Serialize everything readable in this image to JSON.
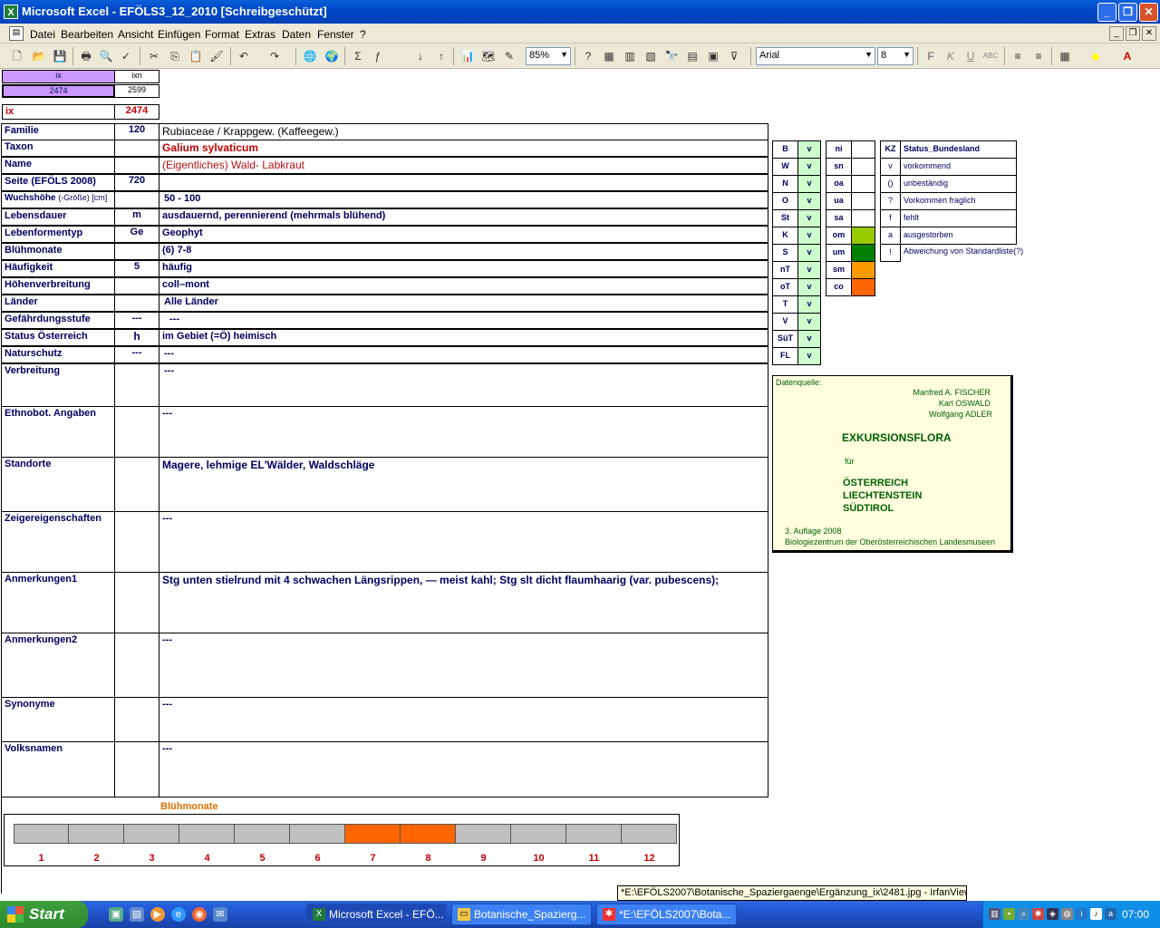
{
  "window": {
    "title": "Microsoft Excel - EFÖLS3_12_2010  [Schreibgeschützt]"
  },
  "menu": [
    "Datei",
    "Bearbeiten",
    "Ansicht",
    "Einfügen",
    "Format",
    "Extras",
    "Daten",
    "Fenster",
    "?"
  ],
  "toolbar": {
    "zoom": "85%",
    "font": "Arial",
    "size": "8"
  },
  "index": {
    "ix_header": "ix",
    "ixn_header": "ixn",
    "ix_value": "2474",
    "ixn_value": "2599",
    "ix_label": "ix",
    "ix_red": "2474"
  },
  "fields": [
    {
      "label": "Familie",
      "code": "120",
      "value": "Rubiaceae  /  Krappgew. (Kaffeegew.)"
    },
    {
      "label": "Taxon",
      "code": "",
      "value": "Galium sylvaticum"
    },
    {
      "label": "Name",
      "code": "",
      "value": "(Eigentliches) Wald- Labkraut"
    },
    {
      "label": "Seite (EFÖLS 2008)",
      "code": "720",
      "value": ""
    },
    {
      "label": "Wuchshöhe",
      "label_suffix": "(-Größe) [cm]",
      "code": "",
      "value": "50 - 100"
    },
    {
      "label": "Lebensdauer",
      "code": "m",
      "value": "ausdauernd, perennierend (mehrmals blühend)"
    },
    {
      "label": "Lebenformentyp",
      "code": "Ge",
      "value": "Geophyt"
    },
    {
      "label": "Blühmonate",
      "code": "",
      "value": "(6) 7-8"
    },
    {
      "label": "Häufigkeit",
      "code": "5",
      "value": "häufig"
    },
    {
      "label": "Höhenverbreitung",
      "code": "",
      "value": "coll–mont"
    },
    {
      "label": "Länder",
      "code": "",
      "value": "Alle Länder"
    },
    {
      "label": "Gefährdungsstufe",
      "code": "---",
      "value": "---"
    },
    {
      "label": "Status Österreich",
      "code": "h",
      "value": "im Gebiet (=Ö) heimisch"
    },
    {
      "label": "Naturschutz",
      "code": "---",
      "value": "---"
    },
    {
      "label": "Verbreitung",
      "code": "",
      "value": "---"
    },
    {
      "label": "Ethnobot. Angaben",
      "code": "",
      "value": "---"
    },
    {
      "label": "Standorte",
      "code": "",
      "value": "Magere, lehmige EL'Wälder, Waldschläge"
    },
    {
      "label": "Zeigereigenschaften",
      "code": "",
      "value": "---"
    },
    {
      "label": "Anmerkungen1",
      "code": "",
      "value": "Stg unten stielrund mit 4 schwachen Längsrippen, — meist kahl; Stg slt dicht flaumhaarig (var. pubescens);"
    },
    {
      "label": "Anmerkungen2",
      "code": "",
      "value": "---"
    },
    {
      "label": "Synonyme",
      "code": "",
      "value": "---"
    },
    {
      "label": "Volksnamen",
      "code": "",
      "value": "---"
    }
  ],
  "regions": [
    {
      "code": "B",
      "v": "v"
    },
    {
      "code": "W",
      "v": "v"
    },
    {
      "code": "N",
      "v": "v"
    },
    {
      "code": "O",
      "v": "v"
    },
    {
      "code": "St",
      "v": "v"
    },
    {
      "code": "K",
      "v": "v"
    },
    {
      "code": "S",
      "v": "v"
    },
    {
      "code": "nT",
      "v": "v"
    },
    {
      "code": "oT",
      "v": "v"
    },
    {
      "code": "T",
      "v": "v"
    },
    {
      "code": "V",
      "v": "v"
    },
    {
      "code": "SüT",
      "v": "v"
    },
    {
      "code": "FL",
      "v": "v"
    }
  ],
  "zones": [
    {
      "code": "ni",
      "color": "#ffffff"
    },
    {
      "code": "sn",
      "color": "#ffffff"
    },
    {
      "code": "oa",
      "color": "#ffffff"
    },
    {
      "code": "ua",
      "color": "#ffffff"
    },
    {
      "code": "sa",
      "color": "#ffffff"
    },
    {
      "code": "om",
      "color": "#99cc00"
    },
    {
      "code": "um",
      "color": "#008000"
    },
    {
      "code": "sm",
      "color": "#ff9900"
    },
    {
      "code": "co",
      "color": "#ff6600"
    }
  ],
  "status_legend": {
    "header_kz": "KZ",
    "header_title": "Status_Bundesland",
    "rows": [
      {
        "kz": "v",
        "text": "vorkommend"
      },
      {
        "kz": "()",
        "text": "unbeständig"
      },
      {
        "kz": "?",
        "text": "Vorkommen fraglich"
      },
      {
        "kz": "f",
        "text": "fehlt"
      },
      {
        "kz": "a",
        "text": "ausgestorben"
      },
      {
        "kz": "!",
        "text": "Abweichung von Standardliste(?)"
      }
    ]
  },
  "source": {
    "label": "Datenquelle:",
    "author1": "Manfred A. FISCHER",
    "author2": "Karl OSWALD",
    "author3": "Wolfgang ADLER",
    "title": "EXKURSIONSFLORA",
    "fuer": "für",
    "c1": "ÖSTERREICH",
    "c2": "LIECHTENSTEIN",
    "c3": "SÜDTIROL",
    "edition": "3. Auflage 2008",
    "publisher": "Biologiezentrum der Oberösterreichischen Landesmuseen"
  },
  "bloom": {
    "title": "Blühmonate",
    "months": [
      "1",
      "2",
      "3",
      "4",
      "5",
      "6",
      "7",
      "8",
      "9",
      "10",
      "11",
      "12"
    ],
    "active": [
      7,
      8
    ],
    "active_color": "#ff6600",
    "inactive_color": "#c0c0c0"
  },
  "tooltip": "*E:\\EFÖLS2007\\Botanische_Spaziergaenge\\Ergänzung_ix\\2481.jpg - IrfanView",
  "taskbar": {
    "start": "Start",
    "tasks": [
      "Microsoft Excel - EFÖ...",
      "Botanische_Spazierg...",
      "*E:\\EFÖLS2007\\Bota..."
    ],
    "clock": "07:00"
  }
}
